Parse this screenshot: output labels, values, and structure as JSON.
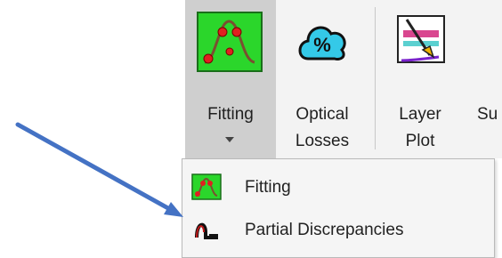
{
  "ribbon": {
    "fitting_label_line1": "Fitting",
    "optical_label_line1": "Optical",
    "optical_label_line2": "Losses",
    "layer_label_line1": "Layer",
    "layer_label_line2": "Plot",
    "cut_label": "Su"
  },
  "menu": {
    "items": [
      {
        "label": "Fitting",
        "icon": "fitting-icon"
      },
      {
        "label": "Partial Discrepancies",
        "icon": "partial-discrepancies-icon"
      }
    ]
  },
  "colors": {
    "icon_green": "#2bd62b",
    "icon_red": "#e02020",
    "cloud_cyan": "#34c9e8",
    "arrow_blue": "#4472c4"
  },
  "annotation": {
    "arrow": "pointer-arrow-icon"
  }
}
